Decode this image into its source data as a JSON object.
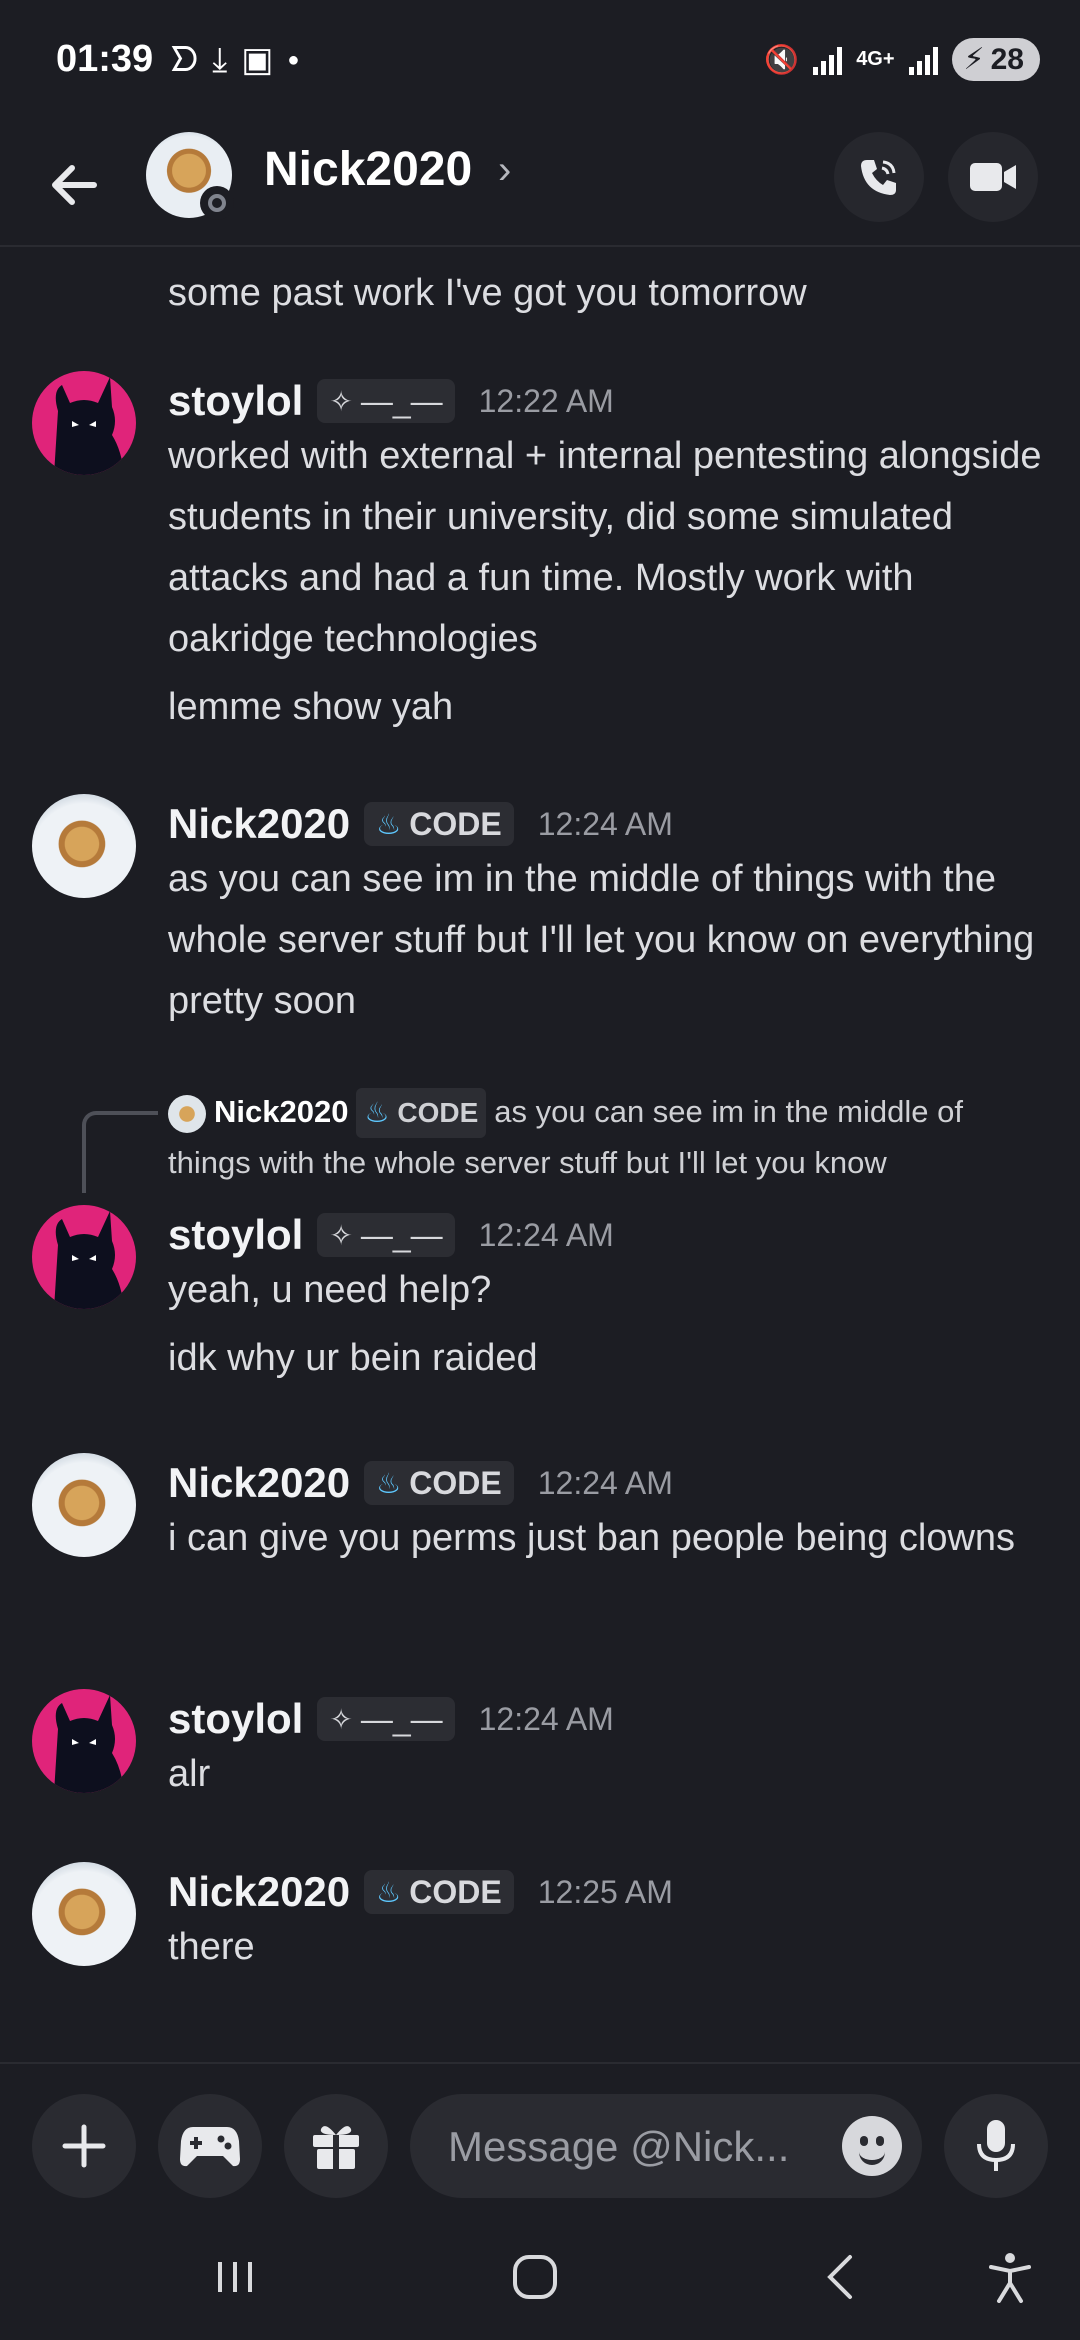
{
  "status_bar": {
    "time": "01:39",
    "network": "4G+",
    "battery": "28"
  },
  "header": {
    "contact_name": "Nick2020"
  },
  "messages": {
    "partial_text": "some past work I've got you tomorrow",
    "groups": [
      {
        "author": "stoylol",
        "tag": "—_—",
        "time": "12:22 AM",
        "lines": [
          "worked with external + internal pentesting alongside students in  their university, did some simulated attacks and had a fun time. Mostly work with oakridge technologies",
          "lemme show yah"
        ]
      },
      {
        "author": "Nick2020",
        "tag": "CODE",
        "time": "12:24 AM",
        "lines": [
          "as you can see im in the middle of things with the whole server stuff but I'll let you know on everything pretty soon"
        ]
      },
      {
        "reply": {
          "author": "Nick2020",
          "tag": "CODE",
          "text": "as you can see im in the middle of things with the whole server stuff but I'll let you know"
        },
        "author": "stoylol",
        "tag": "—_—",
        "time": "12:24 AM",
        "lines": [
          "yeah, u need help?",
          "idk why ur bein raided"
        ]
      },
      {
        "author": "Nick2020",
        "tag": "CODE",
        "time": "12:24 AM",
        "lines": [
          "i can give you perms just ban people being clowns"
        ]
      },
      {
        "author": "stoylol",
        "tag": "—_—",
        "time": "12:24 AM",
        "lines": [
          "alr"
        ]
      },
      {
        "author": "Nick2020",
        "tag": "CODE",
        "time": "12:25 AM",
        "lines": [
          "there"
        ]
      }
    ]
  },
  "composer": {
    "placeholder": "Message @Nick..."
  },
  "colors": {
    "background": "#1c1d23",
    "surface": "#2a2b31",
    "cat_avatar": "#e0247a",
    "timestamp": "#9a9ca3"
  }
}
